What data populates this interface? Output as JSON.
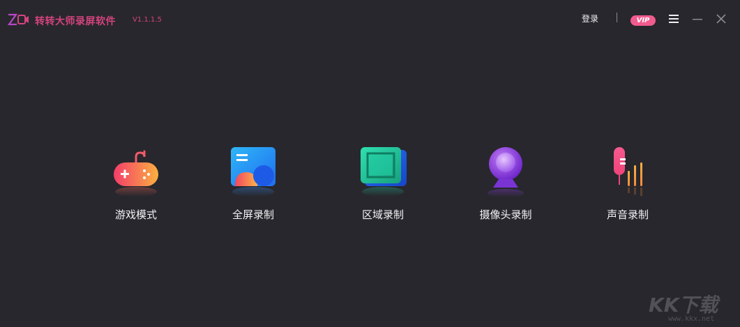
{
  "titlebar": {
    "app_title": "转转大师录屏软件",
    "version": "V1.1.1.5",
    "login_label": "登录",
    "vip_label": "VIP"
  },
  "features": [
    {
      "id": "game",
      "label": "游戏模式"
    },
    {
      "id": "fullscreen",
      "label": "全屏录制"
    },
    {
      "id": "area",
      "label": "区域录制"
    },
    {
      "id": "camera",
      "label": "摄像头录制"
    },
    {
      "id": "audio",
      "label": "声音录制"
    }
  ],
  "watermark": {
    "text": "KK下载",
    "url": "www.kkx.net"
  },
  "colors": {
    "background": "#28272d",
    "brand": "#d4447e",
    "vip": "#f15b8e"
  },
  "icons": [
    "logo-icon",
    "menu-icon",
    "minimize-icon",
    "close-icon",
    "gamepad-icon",
    "fullscreen-icon",
    "area-icon",
    "webcam-icon",
    "microphone-icon"
  ]
}
